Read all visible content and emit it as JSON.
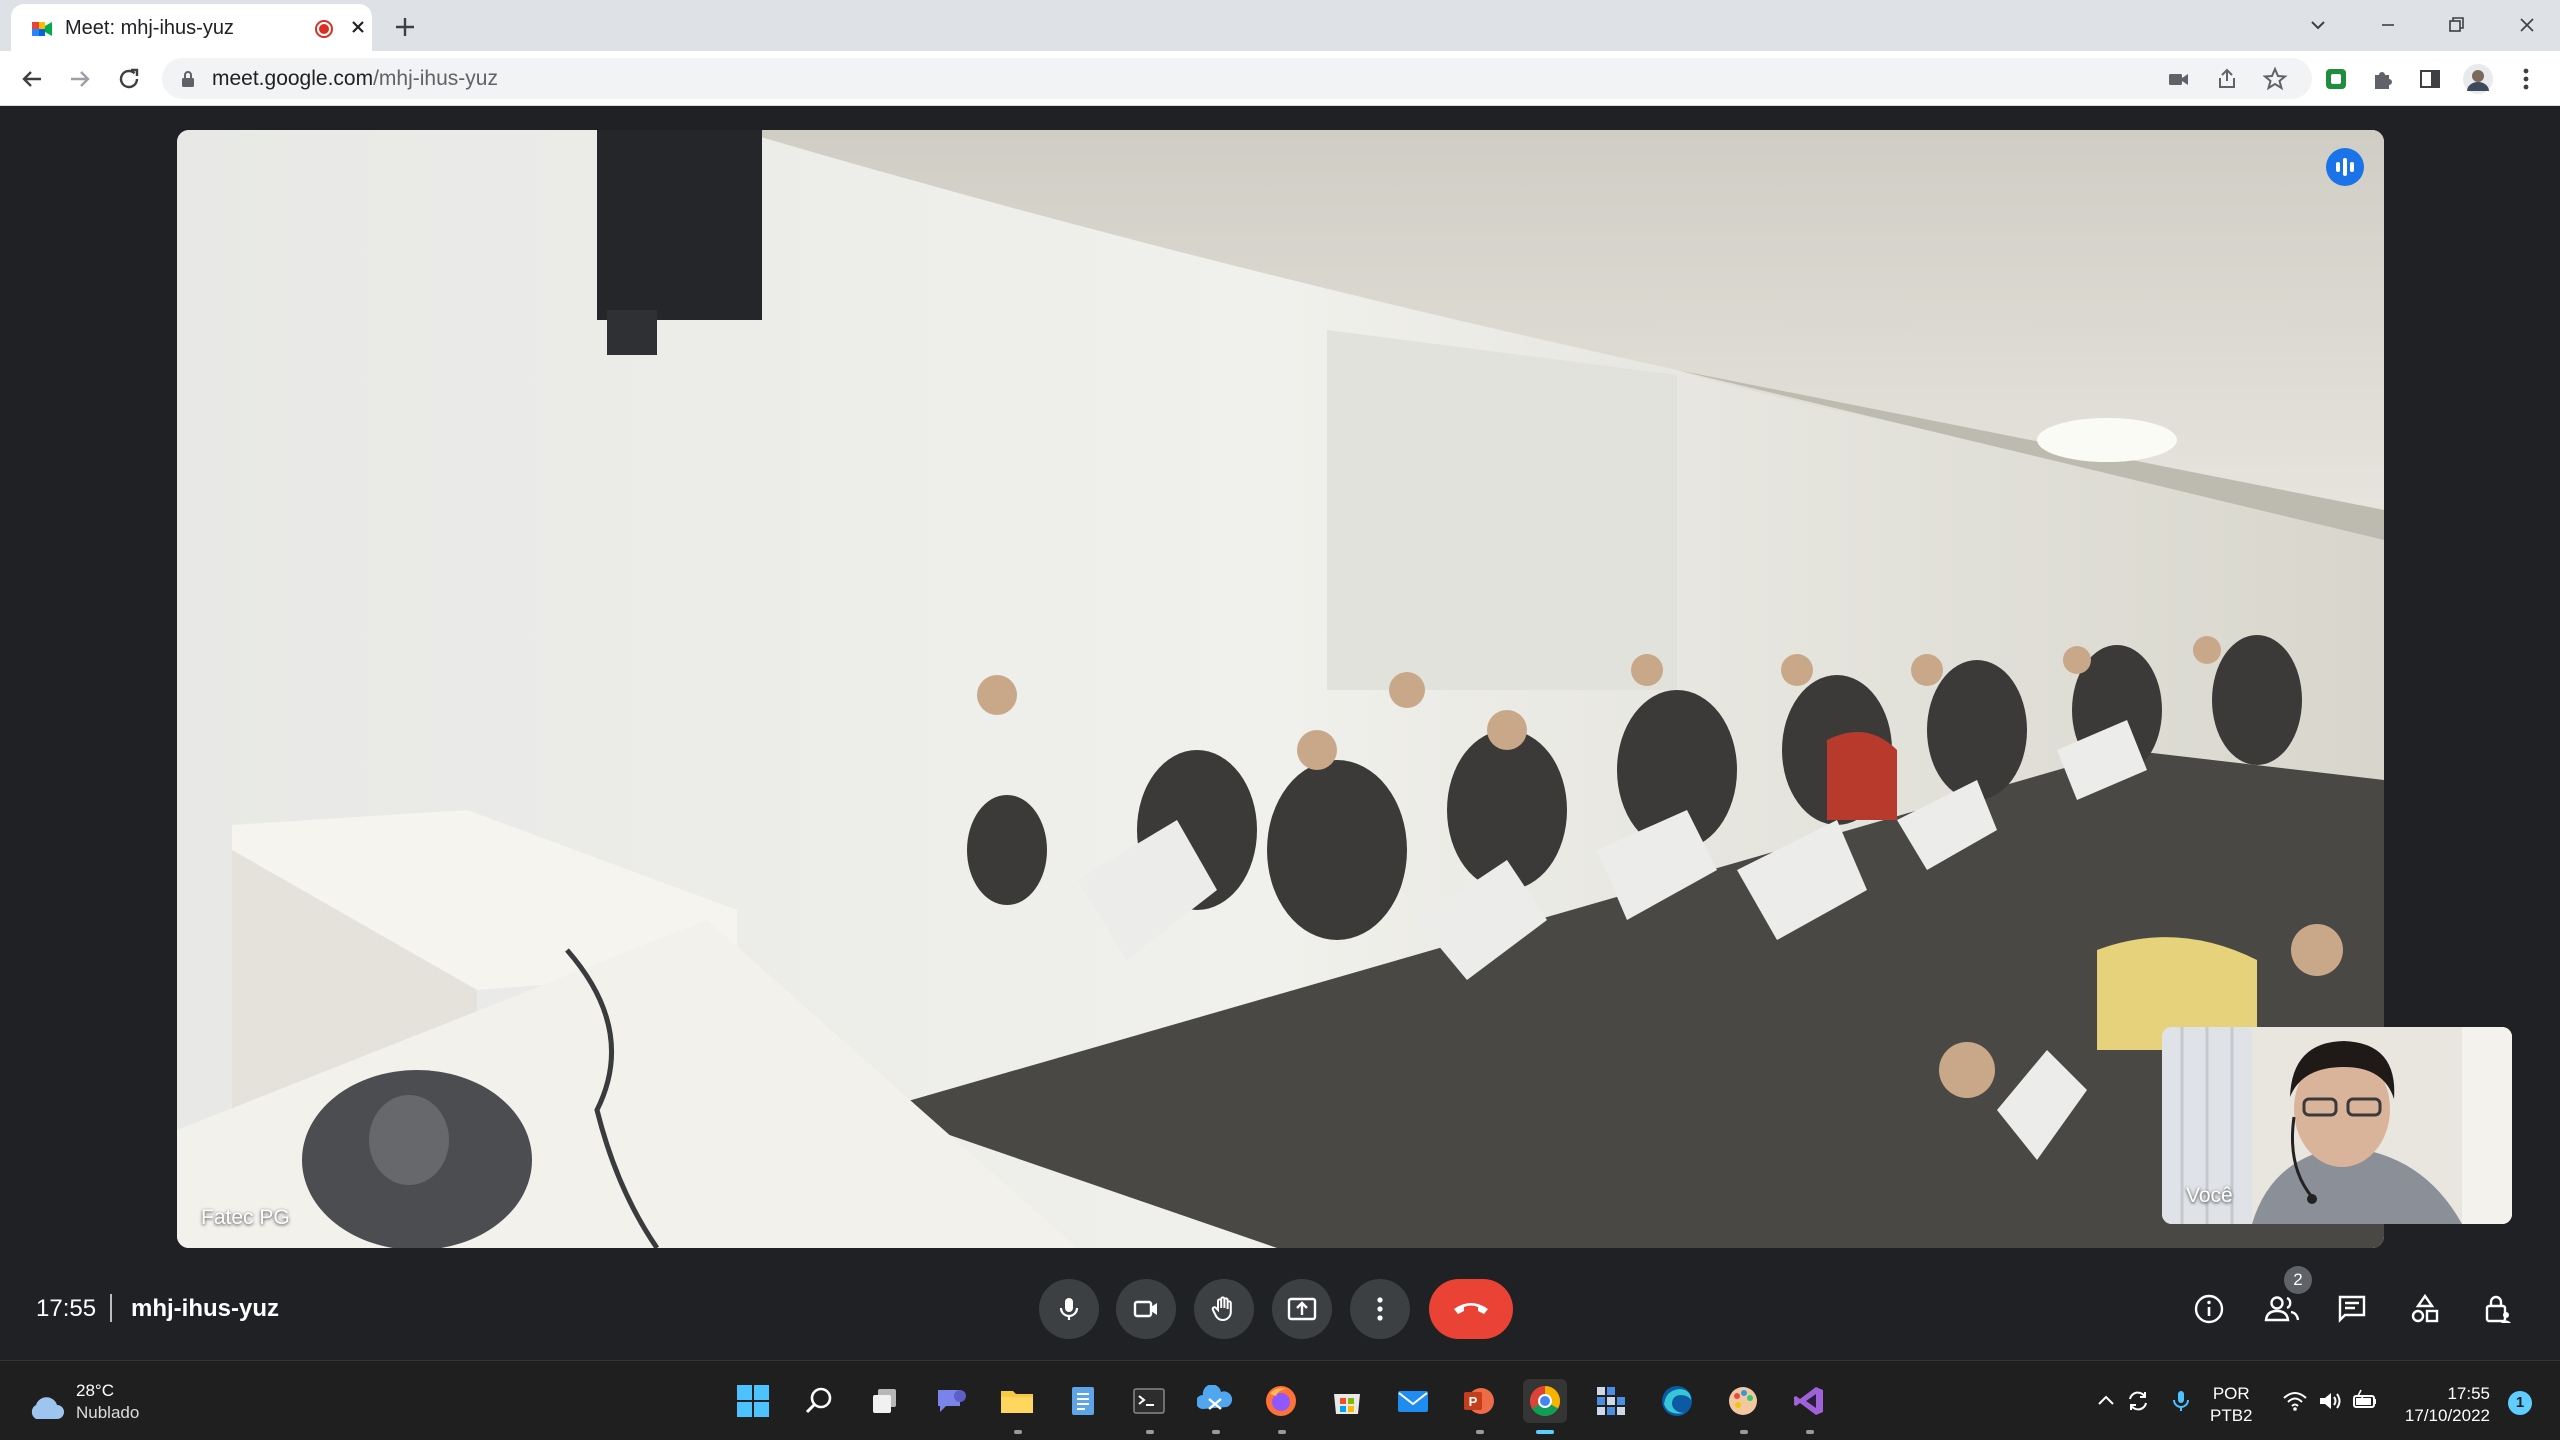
{
  "browser": {
    "tab": {
      "title": "Meet: mhj-ihus-yuz",
      "favicon": "google-meet-icon",
      "recording_color": "#d93025"
    },
    "window_controls": [
      "tab-search",
      "minimize",
      "restore",
      "close"
    ],
    "address_bar": {
      "host": "meet.google.com",
      "path": "/mhj-ihus-yuz"
    },
    "toolbar_icons": [
      "camera-icon",
      "share-icon",
      "bookmark-star-icon",
      "extension-green-icon",
      "puzzle-icon",
      "side-panel-icon",
      "profile-avatar",
      "kebab-menu-icon"
    ]
  },
  "meet": {
    "main_participant": {
      "name": "Fatec PG",
      "speaking_indicator": true,
      "accent": "#1a73e8"
    },
    "self_view": {
      "name": "Você"
    },
    "bottom_bar": {
      "time": "17:55",
      "meeting_code": "mhj-ihus-yuz",
      "controls": [
        "microphone",
        "camera",
        "raise-hand",
        "present-screen",
        "more-options",
        "leave-call"
      ],
      "leave_color": "#ea4335",
      "right_controls": [
        "meeting-details",
        "people",
        "chat",
        "activities",
        "host-controls"
      ],
      "people_count": "2"
    }
  },
  "taskbar": {
    "weather": {
      "temp": "28°C",
      "condition": "Nublado"
    },
    "apps": [
      "start",
      "search",
      "task-view",
      "teams-chat",
      "file-explorer",
      "notepad",
      "terminal",
      "snipping-tool",
      "firefox",
      "microsoft-store",
      "mail",
      "powerpoint",
      "chrome",
      "app-grid",
      "edge",
      "paint",
      "visual-studio"
    ],
    "active_app": "chrome",
    "tray": {
      "language_line1": "POR",
      "language_line2": "PTB2",
      "time": "17:55",
      "date": "17/10/2022",
      "notifications": "1"
    }
  }
}
